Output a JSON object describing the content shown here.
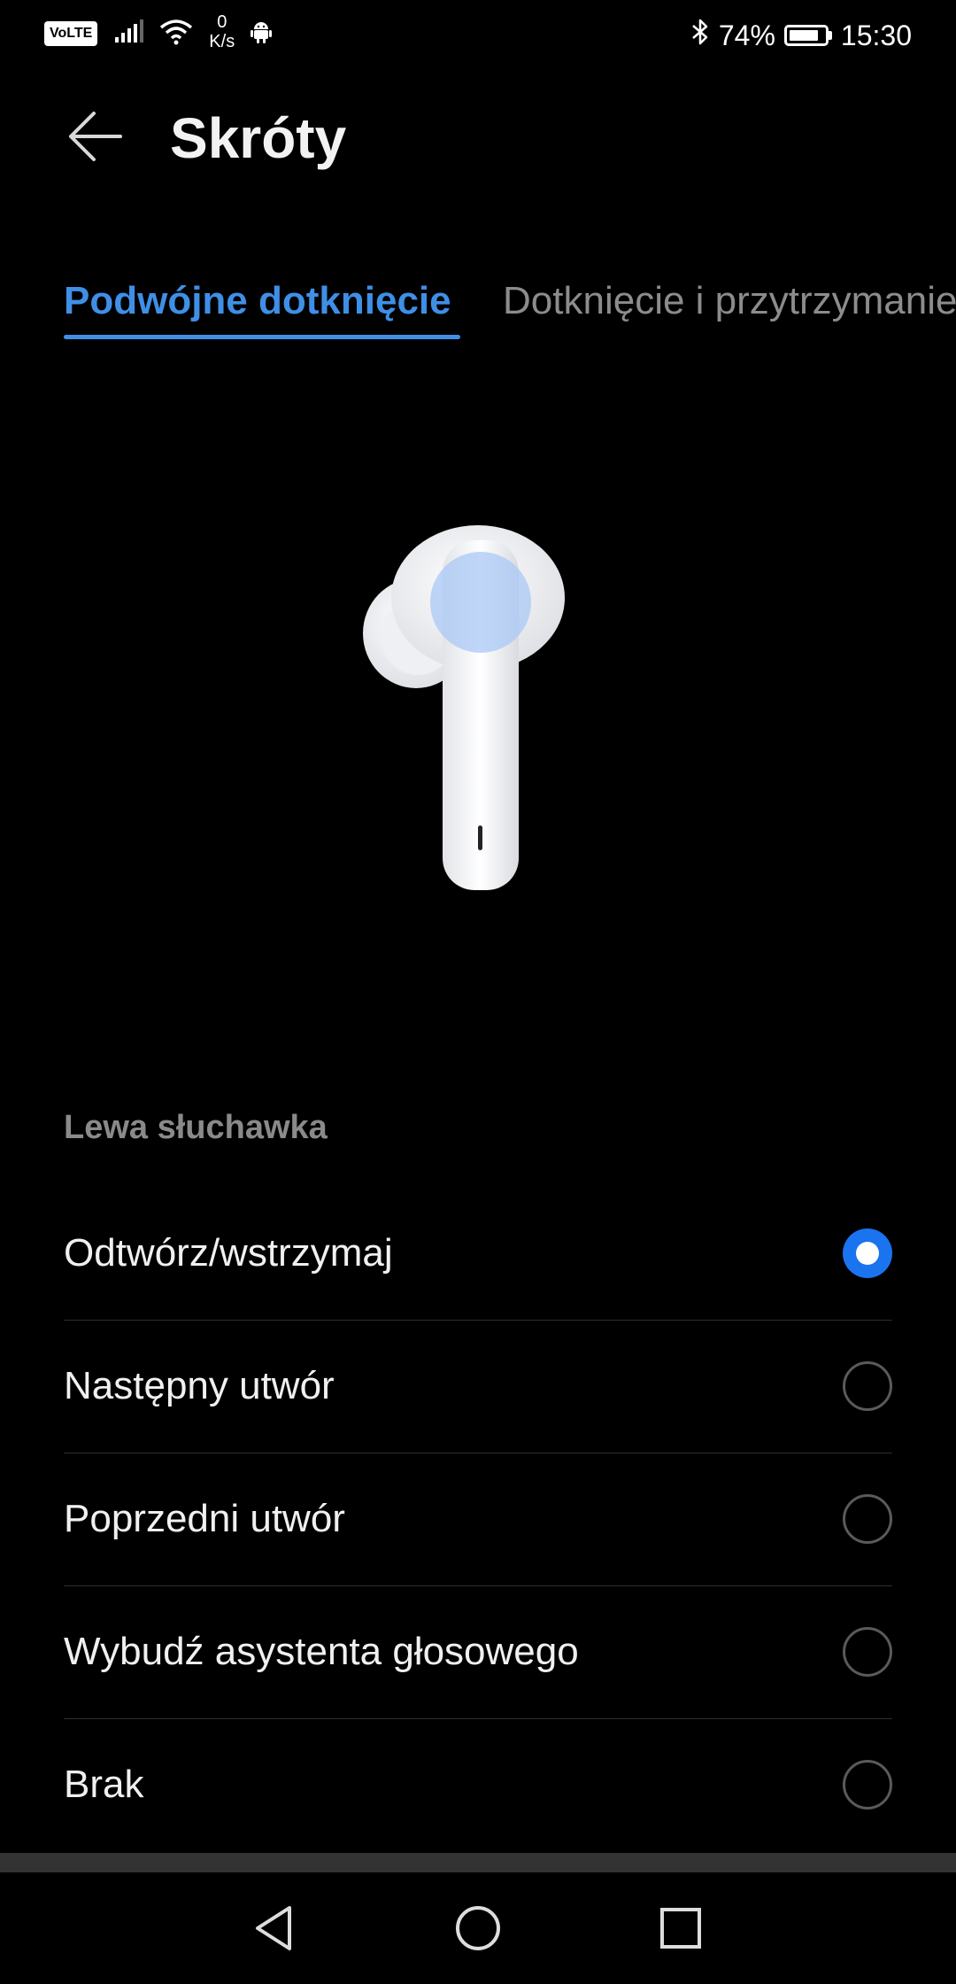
{
  "status_bar": {
    "volte": "VoLTE",
    "net_speed_value": "0",
    "net_speed_unit": "K/s",
    "battery_percent": "74%",
    "time": "15:30"
  },
  "header": {
    "title": "Skróty"
  },
  "tabs": [
    {
      "label": "Podwójne dotknięcie",
      "active": true
    },
    {
      "label": "Dotknięcie i przytrzymanie",
      "active": false
    }
  ],
  "section": {
    "label": "Lewa słuchawka"
  },
  "options": [
    {
      "label": "Odtwórz/wstrzymaj",
      "selected": true
    },
    {
      "label": "Następny utwór",
      "selected": false
    },
    {
      "label": "Poprzedni utwór",
      "selected": false
    },
    {
      "label": "Wybudź asystenta głosowego",
      "selected": false
    },
    {
      "label": "Brak",
      "selected": false
    }
  ],
  "colors": {
    "accent": "#3f8fe6",
    "radio_selected": "#1a74f0",
    "background": "#000000"
  },
  "icons": {
    "back": "arrow-left-icon",
    "nav_back": "triangle-back-icon",
    "nav_home": "circle-home-icon",
    "nav_recent": "square-recent-icon"
  }
}
